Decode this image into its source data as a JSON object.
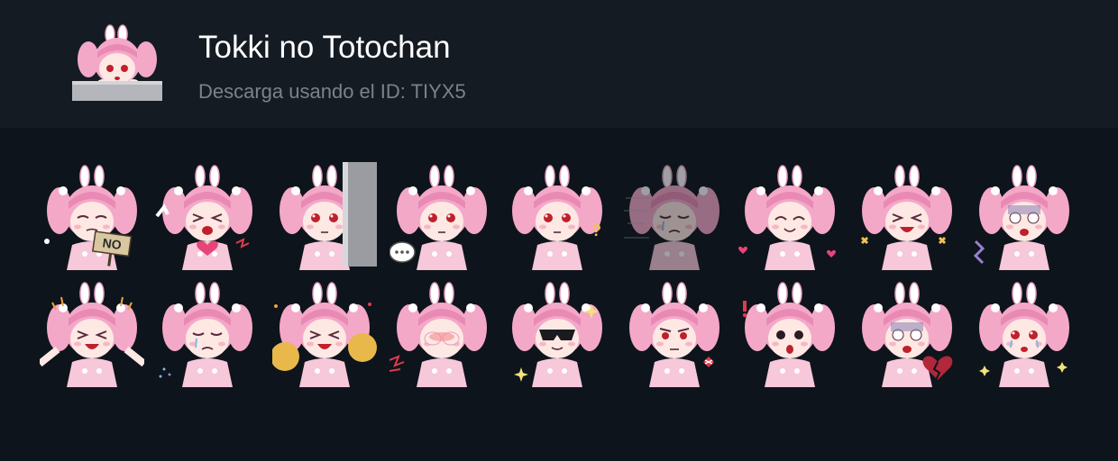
{
  "header": {
    "title": "Tokki no Totochan",
    "subtitle": "Descarga usando el ID: TIYX5",
    "icon": "bunny-girl-peeking-sticker-icon"
  },
  "colors": {
    "header_bg": "#141b23",
    "page_bg": "#0e141b",
    "hair": "#f4a8c8",
    "hair_shade": "#e98ab4",
    "skin": "#fde8e4",
    "outfit": "#f7c7da",
    "eye": "#c0202b"
  },
  "sticker_rows": [
    [
      {
        "name": "sticker-no-sign",
        "sign": "NO",
        "expression": "closed",
        "prop": "sign"
      },
      {
        "name": "sticker-waving-heart",
        "expression": "shout",
        "prop": "heart"
      },
      {
        "name": "sticker-peeking-wall",
        "expression": "stare",
        "prop": "wall"
      },
      {
        "name": "sticker-speech-bubble",
        "expression": "stare",
        "prop": "bubble"
      },
      {
        "name": "sticker-thinking-question",
        "expression": "stare",
        "prop": "question"
      },
      {
        "name": "sticker-faded-sad",
        "expression": "sad",
        "prop": "faded"
      },
      {
        "name": "sticker-happy-hearts",
        "expression": "happy",
        "prop": "hearts"
      },
      {
        "name": "sticker-excited-sparks",
        "expression": "excited",
        "prop": "sparks"
      },
      {
        "name": "sticker-shocked-purple",
        "expression": "shock",
        "prop": "shock"
      }
    ],
    [
      {
        "name": "sticker-cheering-arms",
        "expression": "excited",
        "prop": "cheer"
      },
      {
        "name": "sticker-crying",
        "expression": "sad",
        "prop": "tears"
      },
      {
        "name": "sticker-pompoms",
        "expression": "excited",
        "prop": "pompoms"
      },
      {
        "name": "sticker-hiding-face",
        "expression": "hide",
        "prop": "hide"
      },
      {
        "name": "sticker-sunglasses",
        "expression": "cool",
        "prop": "sunglasses"
      },
      {
        "name": "sticker-angry-fist",
        "expression": "angry",
        "prop": "angry"
      },
      {
        "name": "sticker-surprised-exclaim",
        "expression": "surprised",
        "prop": "exclaim"
      },
      {
        "name": "sticker-broken-heart",
        "expression": "shock",
        "prop": "brokenheart"
      },
      {
        "name": "sticker-teary-pray",
        "expression": "teary",
        "prop": "pray"
      }
    ]
  ]
}
